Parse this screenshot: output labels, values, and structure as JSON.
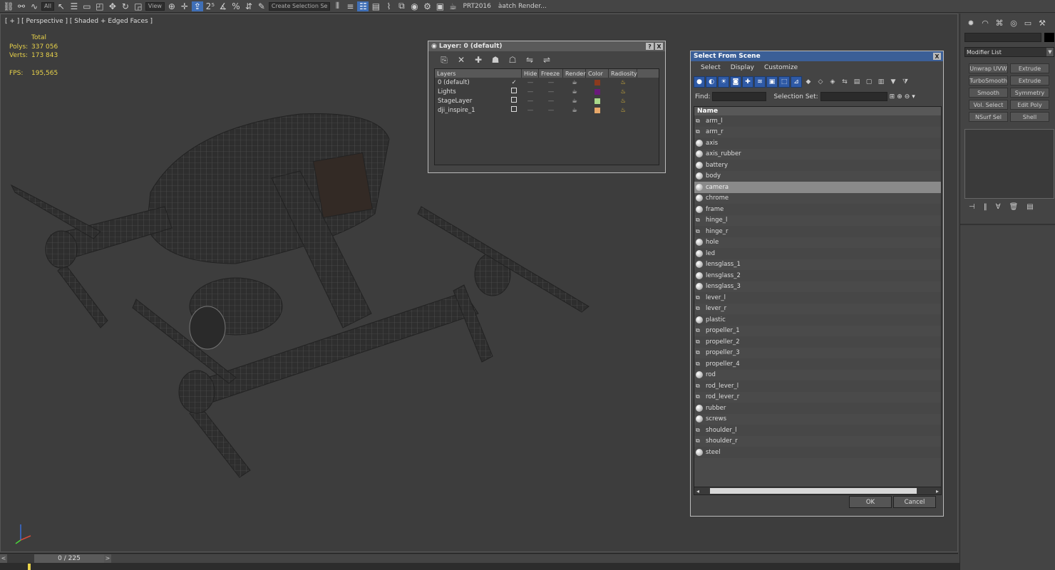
{
  "toolbar": {
    "filter_value": "All",
    "view_value": "View",
    "selection_set_placeholder": "Create Selection Se",
    "prt_label": "PRT2016",
    "batch_render_label": "àatch Render..."
  },
  "viewport": {
    "label": "[ + ] [ Perspective ] [ Shaded + Edged Faces ]",
    "stats": {
      "total_label": "Total",
      "polys_label": "Polys:",
      "polys_value": "337 056",
      "verts_label": "Verts:",
      "verts_value": "173 843",
      "fps_label": "FPS:",
      "fps_value": "195,565"
    }
  },
  "timeline": {
    "frame_label": "0 / 225",
    "prev": "<",
    "next": ">"
  },
  "layer_dialog": {
    "title": "Layer: 0 (default)",
    "help": "?",
    "close": "X",
    "columns": [
      "Layers",
      "Hide",
      "Freeze",
      "Render",
      "Color",
      "Radiosity"
    ],
    "rows": [
      {
        "name": "0 (default)",
        "current": true,
        "color": "#8b3a1e"
      },
      {
        "name": "Lights",
        "current": false,
        "color": "#6a1a7a"
      },
      {
        "name": "StageLayer",
        "current": false,
        "color": "#a9d98a"
      },
      {
        "name": "dji_inspire_1",
        "current": false,
        "color": "#e8a86a"
      }
    ]
  },
  "scene_dialog": {
    "title": "Select From Scene",
    "close": "X",
    "menus": [
      "Select",
      "Display",
      "Customize"
    ],
    "find_label": "Find:",
    "selection_set_label": "Selection Set:",
    "name_header": "Name",
    "objects": [
      {
        "name": "arm_l",
        "type": "group"
      },
      {
        "name": "arm_r",
        "type": "group"
      },
      {
        "name": "axis",
        "type": "object"
      },
      {
        "name": "axis_rubber",
        "type": "object"
      },
      {
        "name": "battery",
        "type": "object"
      },
      {
        "name": "body",
        "type": "object"
      },
      {
        "name": "camera",
        "type": "object"
      },
      {
        "name": "chrome",
        "type": "object"
      },
      {
        "name": "frame",
        "type": "object"
      },
      {
        "name": "hinge_l",
        "type": "group"
      },
      {
        "name": "hinge_r",
        "type": "group"
      },
      {
        "name": "hole",
        "type": "object"
      },
      {
        "name": "led",
        "type": "object"
      },
      {
        "name": "lensglass_1",
        "type": "object"
      },
      {
        "name": "lensglass_2",
        "type": "object"
      },
      {
        "name": "lensglass_3",
        "type": "object"
      },
      {
        "name": "lever_l",
        "type": "group"
      },
      {
        "name": "lever_r",
        "type": "group"
      },
      {
        "name": "plastic",
        "type": "object"
      },
      {
        "name": "propeller_1",
        "type": "group"
      },
      {
        "name": "propeller_2",
        "type": "group"
      },
      {
        "name": "propeller_3",
        "type": "group"
      },
      {
        "name": "propeller_4",
        "type": "group"
      },
      {
        "name": "rod",
        "type": "object"
      },
      {
        "name": "rod_lever_l",
        "type": "group"
      },
      {
        "name": "rod_lever_r",
        "type": "group"
      },
      {
        "name": "rubber",
        "type": "object"
      },
      {
        "name": "screws",
        "type": "object"
      },
      {
        "name": "shoulder_l",
        "type": "group"
      },
      {
        "name": "shoulder_r",
        "type": "group"
      },
      {
        "name": "steel",
        "type": "object"
      }
    ],
    "selected_object": "camera",
    "ok_label": "OK",
    "cancel_label": "Cancel"
  },
  "command_panel": {
    "modifier_list_label": "Modifier List",
    "modifier_buttons": [
      "Unwrap UVW",
      "Extrude",
      "TurboSmooth",
      "Extrude",
      "Smooth",
      "Symmetry",
      "Vol. Select",
      "Edit Poly",
      "NSurf Sel",
      "Shell"
    ]
  }
}
